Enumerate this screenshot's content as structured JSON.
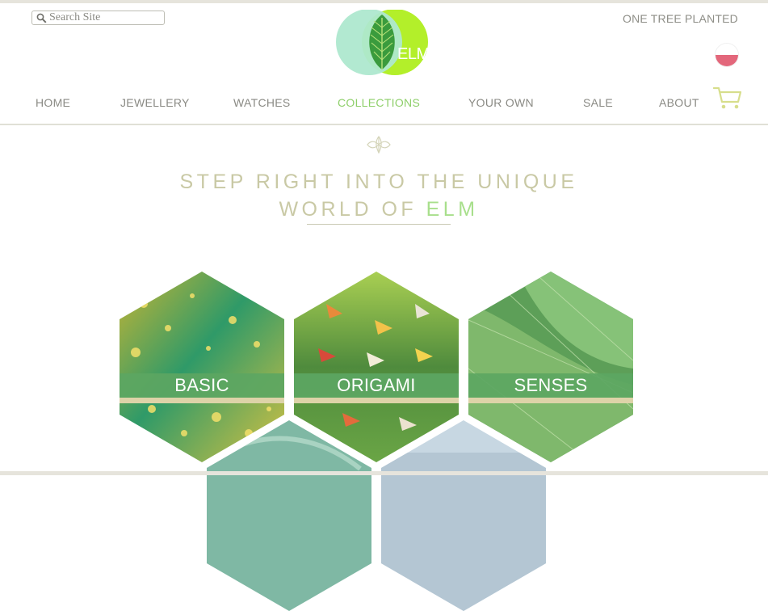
{
  "search": {
    "placeholder": "Search Site",
    "icon": "search-icon"
  },
  "logo": {
    "text": "ELM",
    "colors": {
      "left_circle": "#aee8cf",
      "right_circle": "#b3ef2a",
      "leaf": "#3a9b3d"
    }
  },
  "top_link": "ONE TREE PLANTED",
  "language": {
    "icon": "flag-poland-icon",
    "colors": [
      "#ffffff",
      "#e3677b"
    ]
  },
  "cart": {
    "icon": "shopping-cart-icon",
    "color": "#d7de8c"
  },
  "nav": {
    "items": [
      {
        "label": "HOME",
        "active": false
      },
      {
        "label": "JEWELLERY",
        "active": false
      },
      {
        "label": "WATCHES",
        "active": false
      },
      {
        "label": "COLLECTIONS",
        "active": true
      },
      {
        "label": "YOUR OWN",
        "active": false
      },
      {
        "label": "SALE",
        "active": false
      },
      {
        "label": "ABOUT",
        "active": false
      }
    ],
    "active_color": "#8ecf6a"
  },
  "ornament_icon": "leaf-ornament-icon",
  "headline": {
    "line1": "STEP RIGHT INTO THE UNIQUE",
    "line2_prefix": "WORLD OF ",
    "line2_accent": "ELM"
  },
  "collections": [
    {
      "label": "BASIC"
    },
    {
      "label": "ORIGAMI"
    },
    {
      "label": "SENSES"
    }
  ]
}
